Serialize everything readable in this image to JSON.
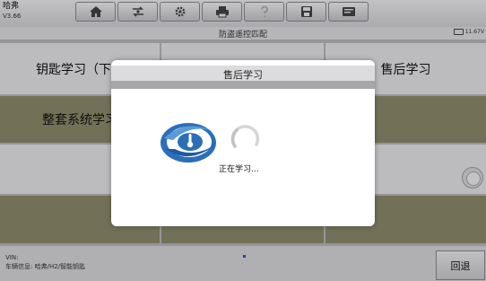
{
  "app": {
    "name": "哈弗",
    "version": "V3.66"
  },
  "toolbar": {
    "tools": [
      {
        "icon": "home-icon"
      },
      {
        "icon": "swap-vehicle-icon"
      },
      {
        "icon": "gear-icon"
      },
      {
        "icon": "printer-icon"
      },
      {
        "icon": "help-icon",
        "disabled": true
      },
      {
        "icon": "save-icon"
      },
      {
        "icon": "feedback-icon"
      }
    ]
  },
  "header": {
    "title": "防盗遥控匹配",
    "battery": "11.67V"
  },
  "menu": {
    "items": [
      "钥匙学习（下线",
      "售后学习",
      "整套系统学习"
    ]
  },
  "footer": {
    "vin_label": "VIN:",
    "vehicle_info": "车辆信息: 哈弗/H2/智能钥匙",
    "back_label": "回退"
  },
  "dialog": {
    "title": "售后学习",
    "message": "正在学习..."
  },
  "colors": {
    "olive_row": "#8f8e6f",
    "logo_blue": "#2b6fb8",
    "accent_dot": "#2c4fd8"
  }
}
